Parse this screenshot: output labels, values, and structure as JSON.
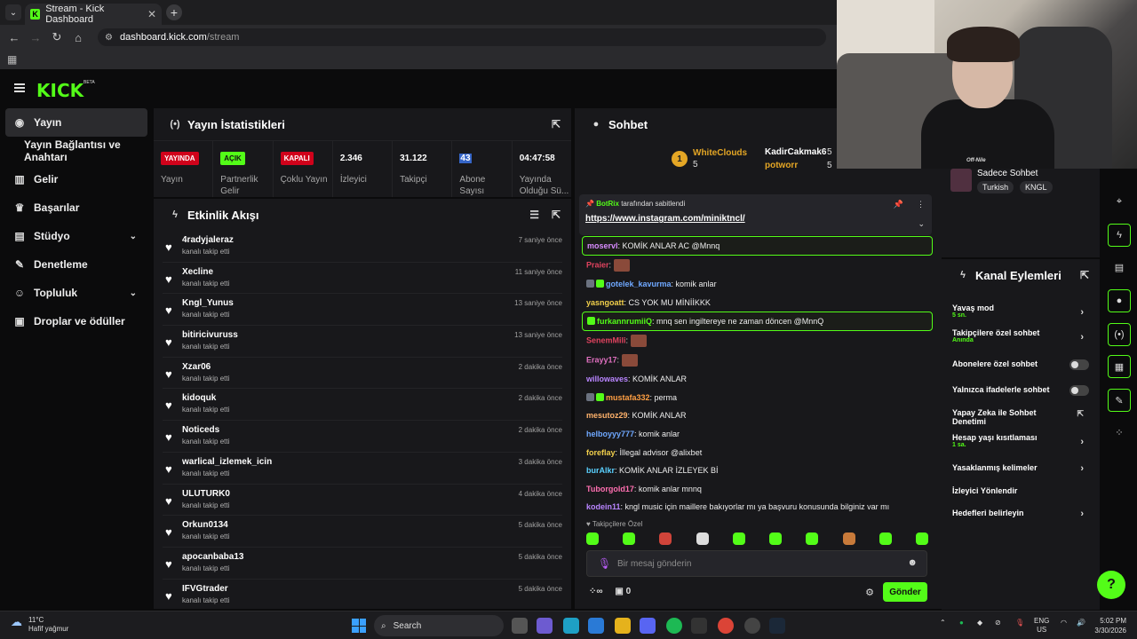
{
  "browser": {
    "tab_title": "Stream - Kick Dashboard",
    "url_host": "dashboard.kick.com",
    "url_path": "/stream"
  },
  "brand": {
    "logo": "KICK",
    "beta": "BETA",
    "accent": "#53fc18"
  },
  "sidebar": {
    "items": [
      {
        "label": "Yayın",
        "icon": "broadcast-icon"
      },
      {
        "label": "Yayın Bağlantısı ve Anahtarı"
      },
      {
        "label": "Gelir",
        "icon": "chart-icon"
      },
      {
        "label": "Başarılar",
        "icon": "trophy-icon"
      },
      {
        "label": "Stüdyo",
        "icon": "studio-icon"
      },
      {
        "label": "Denetleme",
        "icon": "wrench-icon"
      },
      {
        "label": "Topluluk",
        "icon": "community-icon"
      },
      {
        "label": "Droplar ve ödüller",
        "icon": "gift-icon"
      }
    ]
  },
  "stats": {
    "title": "Yayın İstatistikleri",
    "cells": [
      {
        "badge": "YAYINDA",
        "label": "Yayın"
      },
      {
        "badge": "AÇIK",
        "label": "Partnerlik Gelir"
      },
      {
        "badge": "KAPALI",
        "label": "Çoklu Yayın"
      },
      {
        "value": "2.346",
        "label": "İzleyici"
      },
      {
        "value": "31.122",
        "label": "Takipçi"
      },
      {
        "value": "43",
        "label": "Abone Sayısı"
      },
      {
        "value": "04:47:58",
        "label": "Yayında Olduğu Sü..."
      }
    ]
  },
  "activity": {
    "title": "Etkinlik Akışı",
    "items": [
      {
        "name": "4radyjaleraz",
        "desc": "kanalı takip etti",
        "time": "7 saniye önce"
      },
      {
        "name": "Xecline",
        "desc": "kanalı takip etti",
        "time": "11 saniye önce"
      },
      {
        "name": "Kngl_Yunus",
        "desc": "kanalı takip etti",
        "time": "13 saniye önce"
      },
      {
        "name": "bitiricivuruss",
        "desc": "kanalı takip etti",
        "time": "13 saniye önce"
      },
      {
        "name": "Xzar06",
        "desc": "kanalı takip etti",
        "time": "2 dakika önce"
      },
      {
        "name": "kidoquk",
        "desc": "kanalı takip etti",
        "time": "2 dakika önce"
      },
      {
        "name": "Noticeds",
        "desc": "kanalı takip etti",
        "time": "2 dakika önce"
      },
      {
        "name": "warlical_izlemek_icin",
        "desc": "kanalı takip etti",
        "time": "3 dakika önce"
      },
      {
        "name": "ULUTURK0",
        "desc": "kanalı takip etti",
        "time": "4 dakika önce"
      },
      {
        "name": "Orkun0134",
        "desc": "kanalı takip etti",
        "time": "5 dakika önce"
      },
      {
        "name": "apocanbaba13",
        "desc": "kanalı takip etti",
        "time": "5 dakika önce"
      },
      {
        "name": "IFVGtrader",
        "desc": "kanalı takip etti",
        "time": "5 dakika önce"
      }
    ]
  },
  "chat": {
    "title": "Sohbet",
    "leaderboard": [
      {
        "rank": "1",
        "name": "WhiteClouds",
        "count": "5"
      },
      {
        "name": "KadirCakmak6",
        "count": "5"
      },
      {
        "name": "potworr",
        "count": "5"
      }
    ],
    "pinned": {
      "by": "BotRix",
      "suffix": "tarafından sabitlendi",
      "link": "https://www.instagram.com/miniktncl/"
    },
    "messages": [
      {
        "user": "moservl",
        "color": "#d98cff",
        "text": ": KOMİK ANLAR AC @Mnnq",
        "hl": true
      },
      {
        "user": "Praier",
        "color": "#e0435f",
        "text": ":",
        "emote": true
      },
      {
        "user": "gotelek_kavurma",
        "color": "#6fa8ff",
        "text": ": komik anlar",
        "badges": true
      },
      {
        "user": "yasngoatt",
        "color": "#f2d04b",
        "text": ": CS YOK MU MİNİİKKK"
      },
      {
        "user": "furkannrumiiQ",
        "color": "#53fc18",
        "text": ": mnq sen ingiltereye ne zaman döncen @MnnQ",
        "hl": true,
        "mod": true
      },
      {
        "user": "SenemMili",
        "color": "#e0435f",
        "text": ":",
        "emote": true
      },
      {
        "user": "Erayy17",
        "color": "#e070c0",
        "text": ":",
        "emote": true
      },
      {
        "user": "willowaves",
        "color": "#b985ff",
        "text": ": KOMİK ANLAR"
      },
      {
        "user": "mustafa332",
        "color": "#ff9f43",
        "text": ": perma",
        "badges": true
      },
      {
        "user": "mesutoz29",
        "color": "#ffb26b",
        "text": ": KOMİK ANLAR"
      },
      {
        "user": "helboyyy777",
        "color": "#6fa8ff",
        "text": ": komik anlar"
      },
      {
        "user": "foreflay",
        "color": "#f2d04b",
        "text": ": İllegal advisor @alixbet"
      },
      {
        "user": "burAlkr",
        "color": "#5ad1ff",
        "text": ": KOMİK ANLAR İZLEYEK Bİ"
      },
      {
        "user": "Tuborgold17",
        "color": "#ff6fb0",
        "text": ": komik anlar mnnq"
      },
      {
        "user": "kodein11",
        "color": "#b985ff",
        "text": ": kngl music için maillere bakıyorlar mı ya başvuru konusunda bilginiz var mı"
      }
    ],
    "sub_only_label": "Takipçilere Özel",
    "input_placeholder": "Bir mesaj gönderin",
    "footer_count": "0",
    "send_label": "Gönder"
  },
  "sadece": {
    "title": "Sadece Sohbet",
    "chips": [
      "Turkish",
      "KNGL"
    ]
  },
  "kanal": {
    "title": "Kanal Eylemleri",
    "items": [
      {
        "label": "Yavaş mod",
        "sub": "5 sn.",
        "kind": "chev"
      },
      {
        "label": "Takipçilere özel sohbet",
        "sub": "Anında",
        "kind": "chev"
      },
      {
        "label": "Abonelere özel sohbet",
        "kind": "toggle"
      },
      {
        "label": "Yalnızca ifadelerle sohbet",
        "kind": "toggle"
      },
      {
        "label": "Yapay Zeka ile Sohbet Denetimi",
        "kind": "ext"
      },
      {
        "label": "Hesap yaşı kısıtlaması",
        "sub": "1 sa.",
        "kind": "chev"
      },
      {
        "label": "Yasaklanmış kelimeler",
        "kind": "chev"
      },
      {
        "label": "İzleyici Yönlendir",
        "kind": "none"
      },
      {
        "label": "Hedefleri belirleyin",
        "kind": "chev"
      }
    ]
  },
  "webcam": {
    "overlay_text": "Off-Nile"
  },
  "taskbar": {
    "weather_temp": "11°C",
    "weather_desc": "Hafif yağmur",
    "search": "Search",
    "lang1": "ENG",
    "lang2": "US",
    "time": "5:02 PM",
    "date": "3/30/2026"
  }
}
